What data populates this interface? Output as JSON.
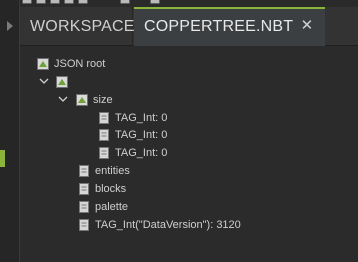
{
  "tabs": [
    {
      "label": "WORKSPACE",
      "active": false
    },
    {
      "label": "COPPERTREE.NBT",
      "active": true
    }
  ],
  "tree": {
    "root_label": "JSON root",
    "nodes": [
      {
        "label": "size"
      },
      {
        "label": "TAG_Int: 0"
      },
      {
        "label": "TAG_Int: 0"
      },
      {
        "label": "TAG_Int: 0"
      },
      {
        "label": "entities"
      },
      {
        "label": "blocks"
      },
      {
        "label": "palette"
      },
      {
        "label": "TAG_Int(\"DataVersion\"): 3120"
      }
    ]
  },
  "colors": {
    "accent": "#8ab43a",
    "background": "#2b2b2b",
    "tabbar": "#333333"
  }
}
